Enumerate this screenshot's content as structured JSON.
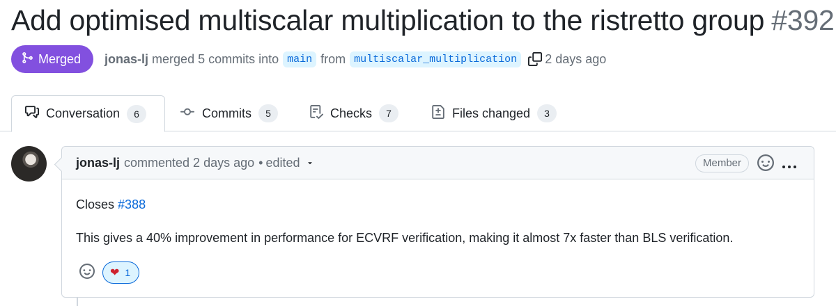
{
  "pr": {
    "title": "Add optimised multiscalar multiplication to the ristretto group",
    "number": "#392",
    "state": "Merged",
    "author": "jonas-lj",
    "merge_text": "merged 5 commits into",
    "base_branch": "main",
    "from_text": "from",
    "head_branch": "multiscalar_multiplication",
    "time": "2 days ago"
  },
  "tabs": [
    {
      "label": "Conversation",
      "count": "6",
      "icon": "comment-discussion-icon",
      "active": true
    },
    {
      "label": "Commits",
      "count": "5",
      "icon": "git-commit-icon"
    },
    {
      "label": "Checks",
      "count": "7",
      "icon": "checklist-icon"
    },
    {
      "label": "Files changed",
      "count": "3",
      "icon": "file-diff-icon"
    }
  ],
  "comment": {
    "author": "jonas-lj",
    "action": "commented 2 days ago",
    "separator": "•",
    "edited": "edited",
    "role": "Member",
    "body": {
      "closes_prefix": "Closes",
      "issue_ref": "#388",
      "text": "This gives a 40% improvement in performance for ECVRF verification, making it almost 7x faster than BLS verification."
    },
    "reactions": [
      {
        "emoji": "heart",
        "glyph": "❤",
        "count": "1"
      }
    ]
  },
  "colors": {
    "merged": "#8250df",
    "link": "#0969da",
    "branch_bg": "#ddf4ff",
    "border": "#d0d7de"
  }
}
